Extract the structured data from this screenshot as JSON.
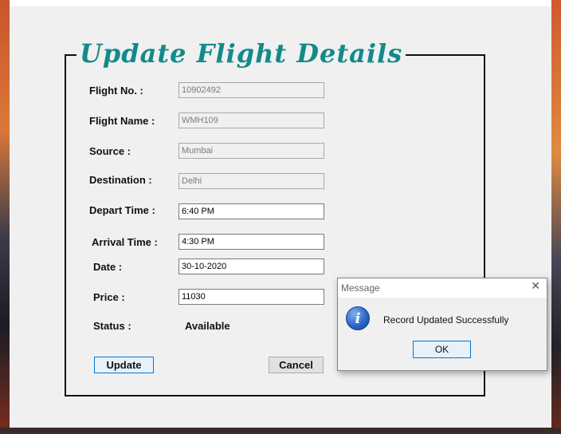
{
  "form": {
    "title": "Update Flight Details",
    "fields": {
      "flight_no": {
        "label": "Flight No. :",
        "value": "10902492"
      },
      "flight_name": {
        "label": "Flight Name :",
        "value": "WMH109"
      },
      "source": {
        "label": "Source :",
        "value": "Mumbai"
      },
      "destination": {
        "label": "Destination :",
        "value": "Delhi"
      },
      "depart_time": {
        "label": "Depart Time :",
        "value": "6:40 PM"
      },
      "arrival_time": {
        "label": "Arrival Time :",
        "value": "4:30 PM"
      },
      "date": {
        "label": "Date :",
        "value": "30-10-2020"
      },
      "price": {
        "label": "Price :",
        "value": "11030"
      }
    },
    "status": {
      "label": "Status :",
      "value": "Available"
    },
    "buttons": {
      "update": "Update",
      "cancel": "Cancel"
    }
  },
  "dialog": {
    "title": "Message",
    "close_glyph": "✕",
    "icon": "information-icon",
    "icon_glyph": "i",
    "message": "Record Updated Successfully",
    "ok_label": "OK"
  },
  "colors": {
    "title": "#138a8a",
    "button_focus_border": "#0078d7"
  }
}
